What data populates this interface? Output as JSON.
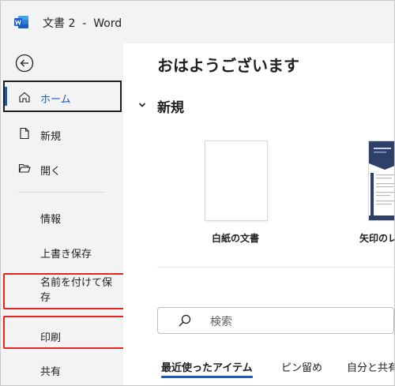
{
  "window": {
    "title": "文書 2  -  Word",
    "app_icon": "word-logo-icon"
  },
  "sidebar": {
    "back_icon": "back-arrow-icon",
    "items": [
      {
        "label": "ホーム",
        "icon": "home-icon",
        "selected": true
      },
      {
        "label": "新規",
        "icon": "new-document-icon"
      },
      {
        "label": "開く",
        "icon": "folder-open-icon"
      },
      {
        "label": "情報"
      },
      {
        "label": "上書き保存"
      },
      {
        "label": "名前を付けて保存"
      },
      {
        "label": "印刷"
      },
      {
        "label": "共有"
      }
    ]
  },
  "main": {
    "greeting": "おはようございます",
    "new_section": {
      "title": "新規",
      "expanded": true
    },
    "templates": [
      {
        "label": "白紙の文書"
      },
      {
        "label": "矢印のレ"
      }
    ],
    "search": {
      "placeholder": "検索"
    },
    "tabs": [
      {
        "label": "最近使ったアイテム",
        "selected": true
      },
      {
        "label": "ピン留め"
      },
      {
        "label": "自分と共有"
      }
    ]
  },
  "colors": {
    "accent": "#185abd",
    "highlight": "#e52424",
    "background": "#f3f3f3",
    "content": "#ffffff"
  }
}
